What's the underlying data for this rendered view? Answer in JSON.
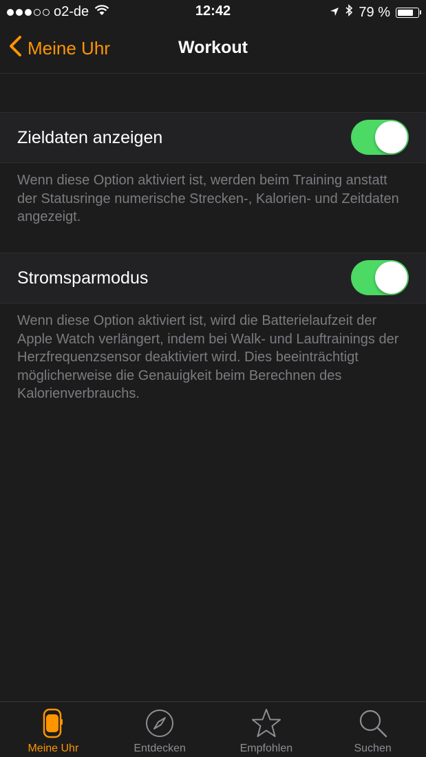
{
  "status_bar": {
    "carrier": "o2-de",
    "time": "12:42",
    "battery": "79 %",
    "battery_level": 0.79
  },
  "nav": {
    "back_label": "Meine Uhr",
    "title": "Workout"
  },
  "settings": [
    {
      "label": "Zieldaten anzeigen",
      "enabled": true,
      "footnote": "Wenn diese Option aktiviert ist, werden beim Training anstatt der Statusringe numerische Strecken-, Kalorien- und Zeitdaten angezeigt."
    },
    {
      "label": "Stromsparmodus",
      "enabled": true,
      "footnote": "Wenn diese Option aktiviert ist, wird die Batterielaufzeit der Apple Watch verlängert, indem bei Walk- und Lauftrainings der Herzfrequenzsensor deaktiviert wird. Dies beeinträchtigt möglicherweise die Genauigkeit beim Berechnen des Kalorienverbrauchs."
    }
  ],
  "tabs": [
    {
      "label": "Meine Uhr",
      "icon": "watch-icon",
      "active": true
    },
    {
      "label": "Entdecken",
      "icon": "compass-icon",
      "active": false
    },
    {
      "label": "Empfohlen",
      "icon": "star-icon",
      "active": false
    },
    {
      "label": "Suchen",
      "icon": "search-icon",
      "active": false
    }
  ],
  "colors": {
    "accent": "#ff9500",
    "toggle_on": "#4cd964",
    "background": "#1c1c1d"
  }
}
